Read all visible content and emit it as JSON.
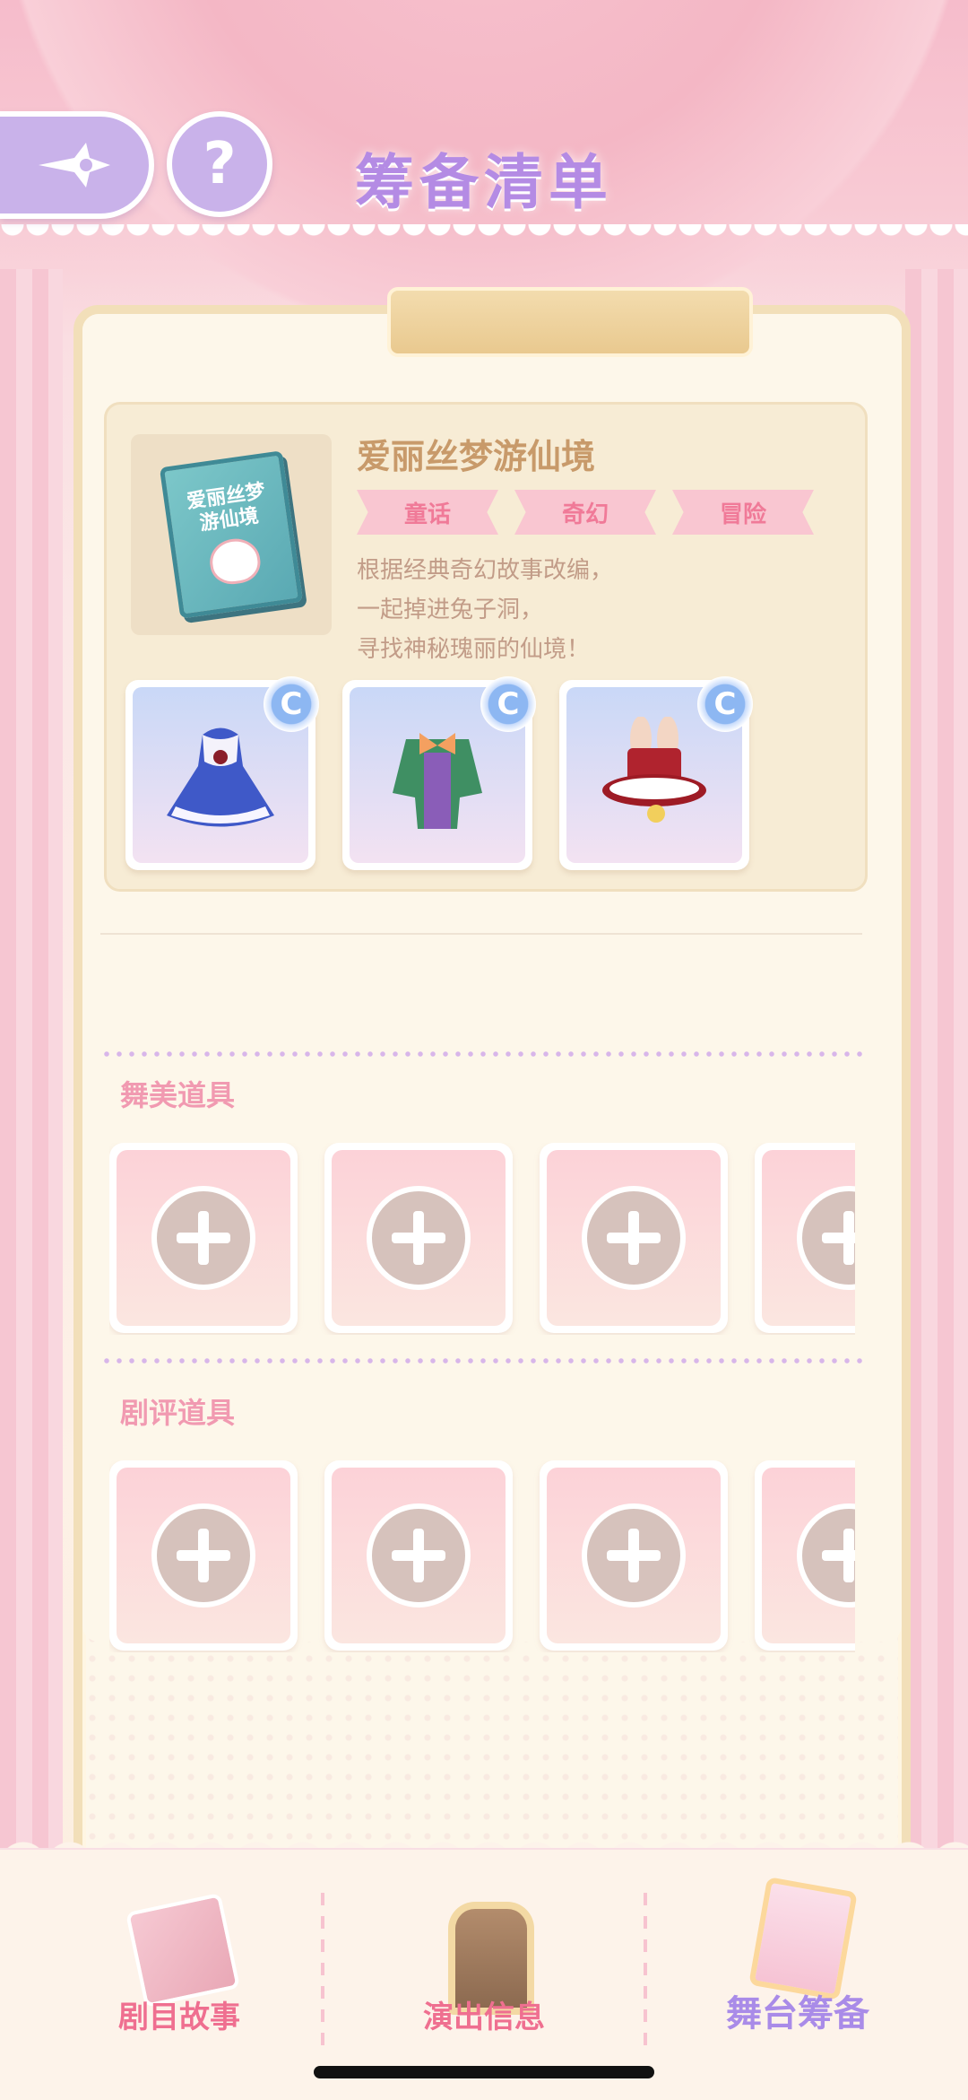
{
  "header": {
    "title": "筹备清单"
  },
  "buttons": {
    "back_icon": "sparkle-arrow-icon",
    "help_label": "?"
  },
  "story": {
    "cover_text": "爱丽丝梦游仙境",
    "title": "爱丽丝梦游仙境",
    "tags": [
      "童话",
      "奇幻",
      "冒险"
    ],
    "description": [
      "根据经典奇幻故事改编，",
      "一起掉进兔子洞，",
      "寻找神秘瑰丽的仙境！"
    ],
    "outfits": [
      {
        "name": "blue-dress",
        "rarity": "C"
      },
      {
        "name": "green-suit",
        "rarity": "C"
      },
      {
        "name": "rabbit-hat",
        "rarity": "C"
      }
    ]
  },
  "sections": {
    "stage_props": {
      "title": "舞美道具"
    },
    "review_props": {
      "title": "剧评道具"
    }
  },
  "nav": {
    "items": [
      {
        "label": "剧目故事"
      },
      {
        "label": "演出信息"
      },
      {
        "label": "舞台筹备"
      }
    ],
    "active_index": 2
  },
  "colors": {
    "accent": "#b48be4",
    "pink": "#ef6f90",
    "tag_bg": "#f9c6d1"
  }
}
